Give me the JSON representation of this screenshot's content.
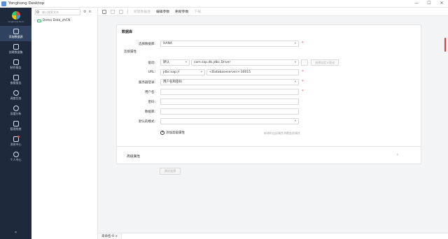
{
  "window": {
    "title": "Yonghong Desktop"
  },
  "window_controls": {
    "minimize": "—",
    "maximize": "☐",
    "close": "✕"
  },
  "brand": {
    "sub": "Yonghong Tech"
  },
  "sidebar": {
    "items": [
      {
        "label": "添加数据源",
        "icon": "database-icon",
        "active": true
      },
      {
        "label": "创建数据集",
        "icon": "dataset-icon",
        "active": false
      },
      {
        "label": "制作报告",
        "icon": "report-icon",
        "active": false
      },
      {
        "label": "查看报告",
        "icon": "view-report-icon",
        "active": false
      },
      {
        "label": "调度任务",
        "icon": "clock-icon",
        "active": false
      },
      {
        "label": "深度分析",
        "icon": "analysis-icon",
        "active": false
      },
      {
        "label": "管理系统",
        "icon": "shield-icon",
        "active": false
      },
      {
        "label": "消息中心",
        "icon": "bell-icon",
        "active": false
      },
      {
        "label": "个人中心",
        "icon": "user-icon",
        "active": false
      }
    ],
    "collapse_icon": "«"
  },
  "tree": {
    "search_placeholder": "输入搜索文本",
    "tools": [
      "⚙",
      "≡"
    ],
    "items": [
      {
        "label": "Demo Data_zhCN",
        "chevron": "›"
      }
    ]
  },
  "toolbar": {
    "buttons": [
      {
        "label": "新建数据连",
        "enabled": false
      },
      {
        "label": "编辑参数",
        "enabled": true
      },
      {
        "label": "刷新参数",
        "enabled": true
      },
      {
        "label": "下载",
        "enabled": false
      }
    ]
  },
  "form": {
    "title": "数据库",
    "db_type_label": "选择数据库:",
    "db_type_value": "HANA",
    "connection_section": "连接属性",
    "driver_label": "驱动:",
    "driver_mode": "默认",
    "driver_class": "com.sap.db.jdbc.Driver",
    "driver_button": "选择自定义驱动",
    "url_label": "URL:",
    "url_prefix": "jdbc:sap://",
    "url_value": "<Databaseserver>:30015",
    "login_label": "服务器登录:",
    "login_value": "用户名和密码",
    "user_label": "用户名:",
    "password_label": "密码:",
    "database_label": "数据库:",
    "default_schema_label": "默认的模式:",
    "add_property": "添加高级属性",
    "hint": "新增的连接属性将覆盖原属性",
    "required_mark": "*",
    "select_caret": "▾"
  },
  "advanced": {
    "title": "高级属性",
    "chevron": "›"
  },
  "test_button": "测试连接",
  "bottom_tabs": [
    {
      "label": "未命名-0",
      "close": "×"
    }
  ]
}
